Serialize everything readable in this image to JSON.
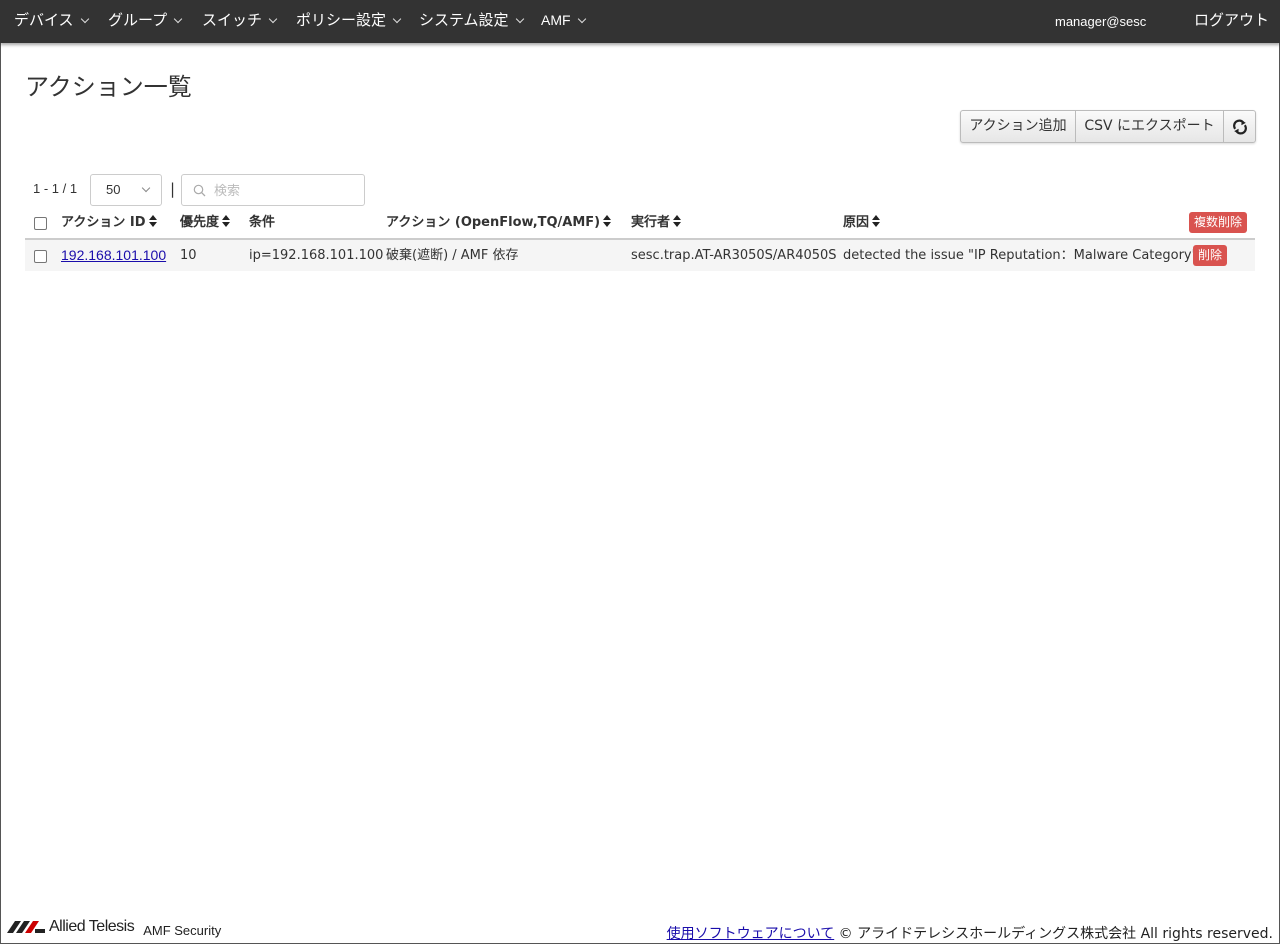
{
  "nav": {
    "items": [
      {
        "label": "デバイス"
      },
      {
        "label": "グループ"
      },
      {
        "label": "スイッチ"
      },
      {
        "label": "ポリシー設定"
      },
      {
        "label": "システム設定"
      },
      {
        "label": "AMF"
      }
    ],
    "user": "manager@sesc",
    "logout": "ログアウト"
  },
  "page": {
    "title": "アクション一覧"
  },
  "toolbar": {
    "add_action": "アクション追加",
    "export_csv": "CSV にエクスポート",
    "refresh_icon": "refresh-icon"
  },
  "list_controls": {
    "pager": "1 - 1 / 1",
    "page_size": "50",
    "separator": "|",
    "search_placeholder": "検索"
  },
  "table": {
    "columns": [
      "アクション ID",
      "優先度",
      "条件",
      "アクション (OpenFlow,TQ/AMF)",
      "実行者",
      "原因"
    ],
    "bulk_delete": "複数削除",
    "rows": [
      {
        "action_id": "192.168.101.100",
        "priority": "10",
        "condition": "ip=192.168.101.100",
        "action": "破棄(遮断) / AMF 依存",
        "executor": "sesc.trap.AT-AR3050S/AR4050S",
        "reason": "detected the issue \"IP Reputation：Malware Category\"",
        "delete_label": "削除"
      }
    ]
  },
  "footer": {
    "brand": "Allied Telesis",
    "product": "AMF Security",
    "software_link": "使用ソフトウェアについて",
    "copyright": "© アライドテレシスホールディングス株式会社 All rights reserved."
  },
  "colors": {
    "navbar": "#333333",
    "danger": "#d9534f",
    "link": "#1a0dab",
    "row_bg": "#f5f5f5"
  }
}
